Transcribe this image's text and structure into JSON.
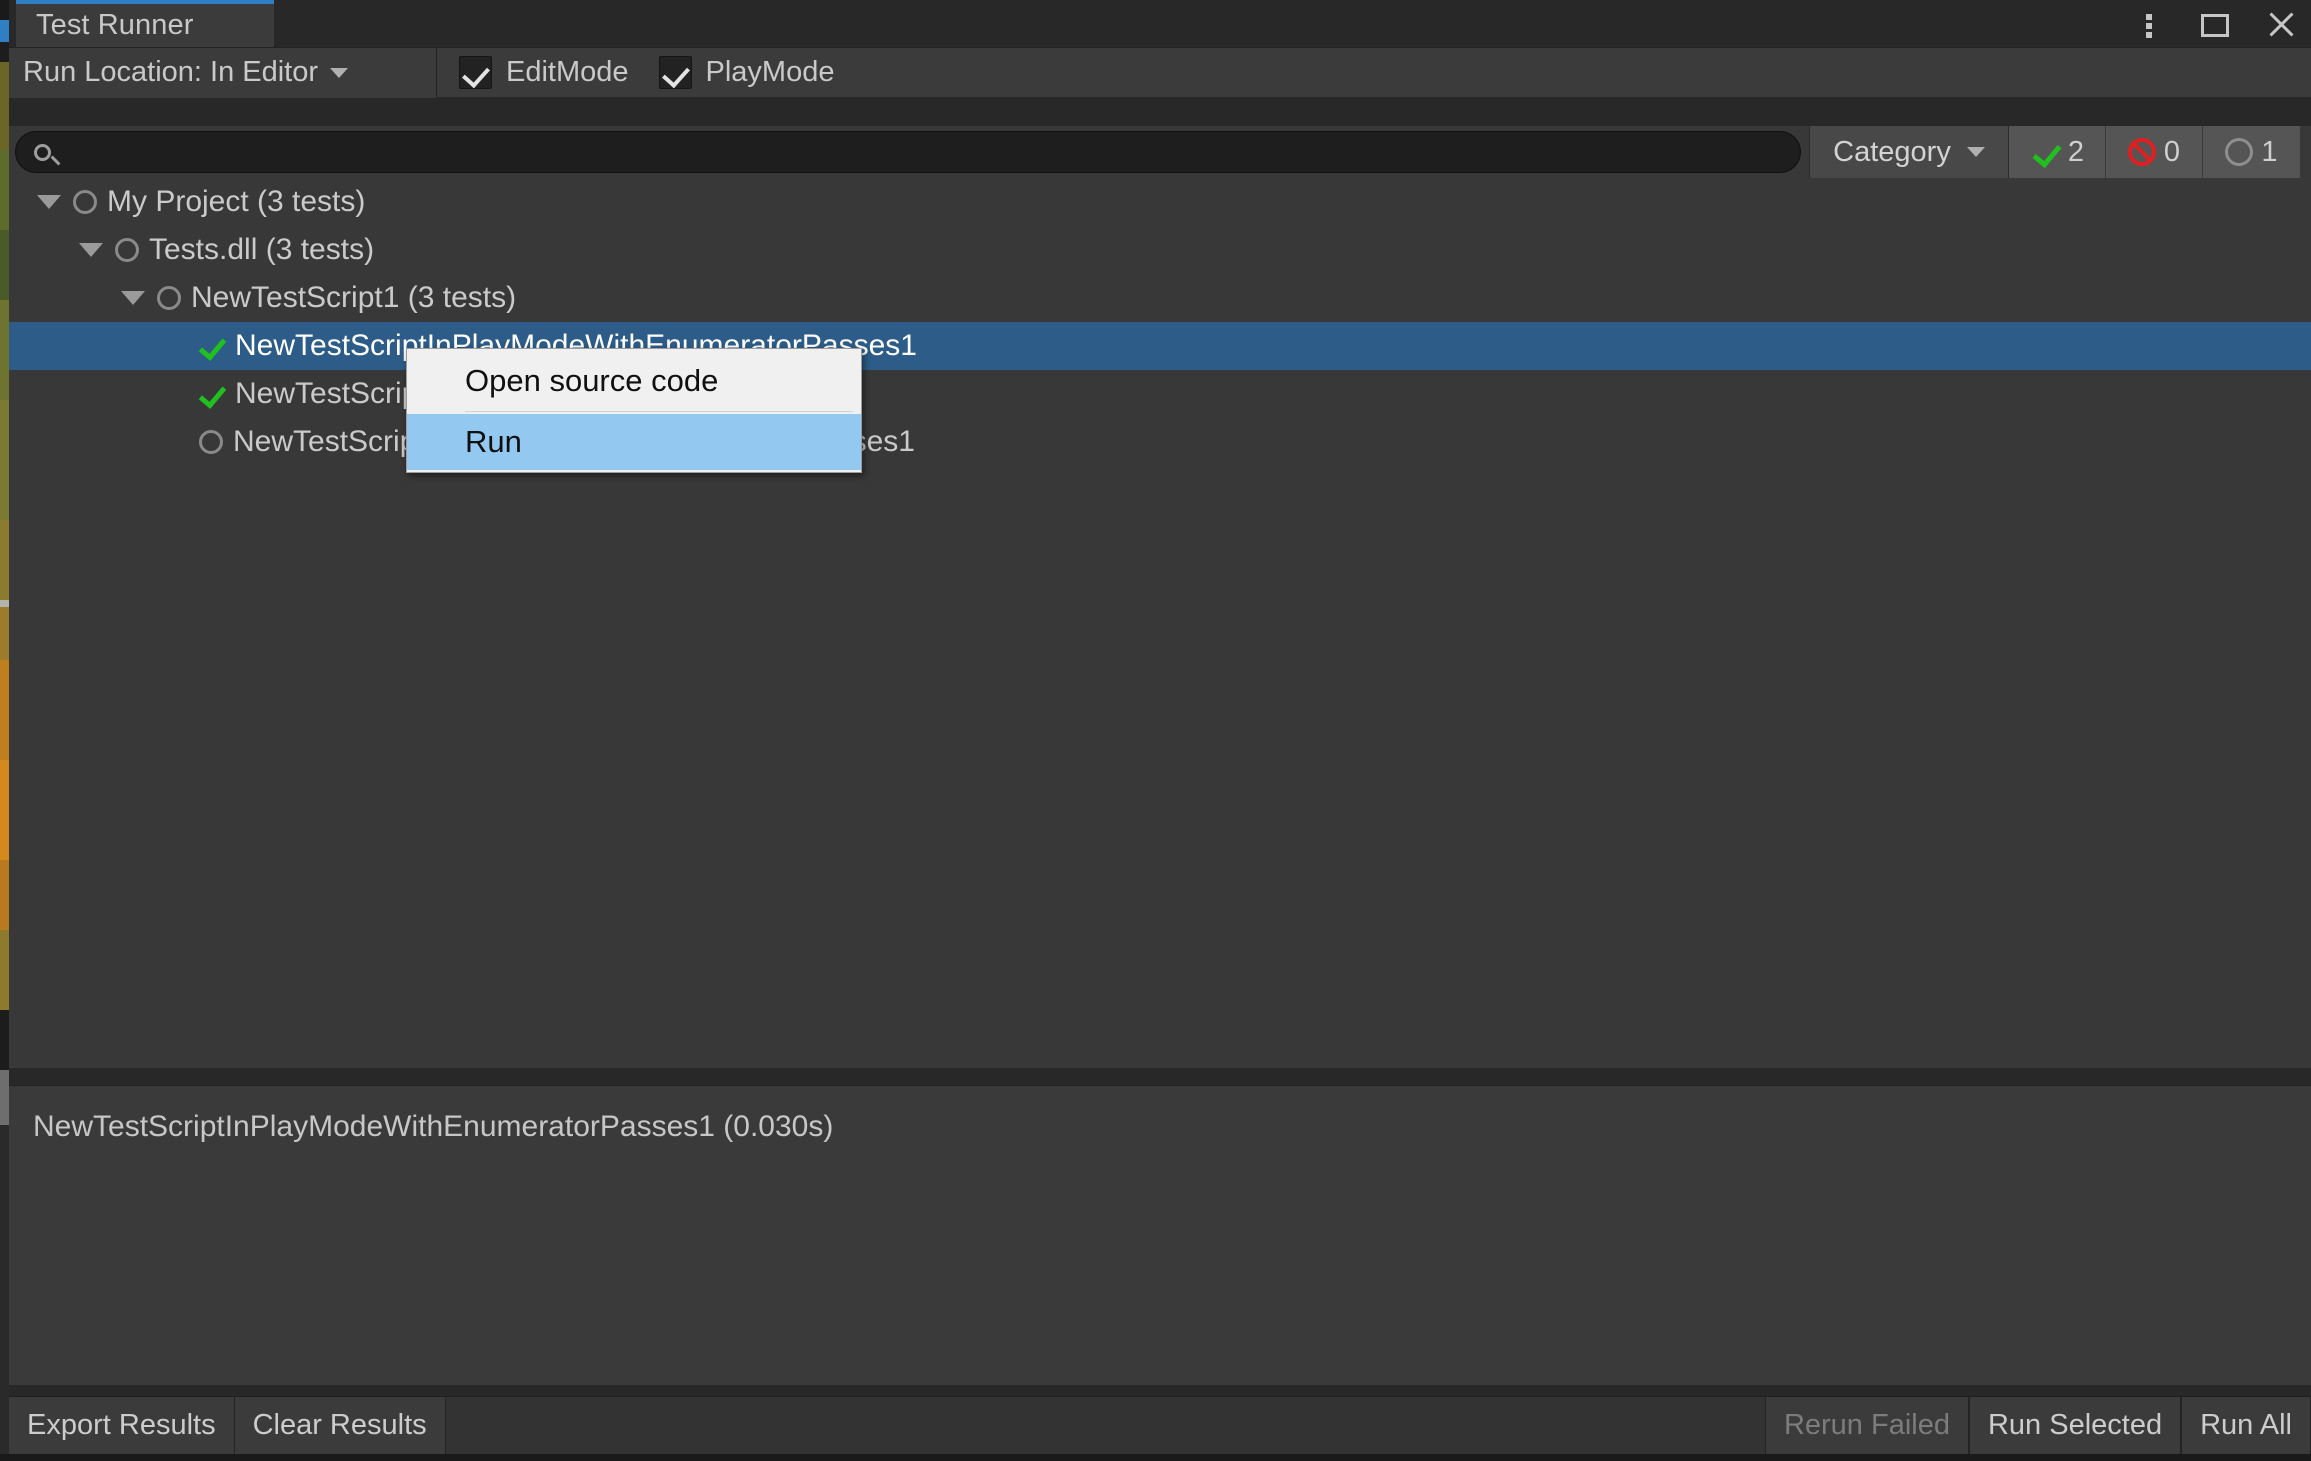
{
  "window": {
    "tab_label": "Test Runner",
    "controls": [
      {
        "name": "kebab-menu-icon",
        "label": "More options"
      },
      {
        "name": "maximize-icon",
        "label": "Maximize"
      },
      {
        "name": "close-icon",
        "label": "Close"
      }
    ]
  },
  "toolbar": {
    "run_location": "Run Location: In Editor",
    "modes": [
      {
        "label": "EditMode",
        "checked": true
      },
      {
        "label": "PlayMode",
        "checked": true
      }
    ]
  },
  "search": {
    "value": "",
    "placeholder": "",
    "icon": "search-icon",
    "category_label": "Category",
    "counts": {
      "passed": "2",
      "failed": "0",
      "not_run": "1"
    }
  },
  "tree": {
    "rows": [
      {
        "label": "My Project (3 tests)",
        "depth": 0,
        "expanded": true,
        "status": "not-run",
        "selected": false
      },
      {
        "label": "Tests.dll (3 tests)",
        "depth": 1,
        "expanded": true,
        "status": "not-run",
        "selected": false
      },
      {
        "label": "NewTestScript1 (3 tests)",
        "depth": 2,
        "expanded": true,
        "status": "not-run",
        "selected": false
      },
      {
        "label": "NewTestScriptInPlayModeWithEnumeratorPasses1",
        "depth": 3,
        "expanded": false,
        "status": "passed",
        "selected": true
      },
      {
        "label": "NewTestScriptSimplePasses1",
        "depth": 3,
        "expanded": false,
        "status": "passed",
        "selected": false
      },
      {
        "label": "NewTestScriptInPlayModeWithEnumeratorPasses1",
        "depth": 3,
        "expanded": false,
        "status": "not-run",
        "selected": false
      }
    ]
  },
  "context_menu": {
    "items": [
      {
        "label": "Open source code",
        "highlighted": false
      },
      {
        "label": "Run",
        "highlighted": true
      }
    ]
  },
  "detail": {
    "text": "NewTestScriptInPlayModeWithEnumeratorPasses1 (0.030s)"
  },
  "bottom_bar": {
    "left_buttons": [
      {
        "label": "Export Results",
        "disabled": false
      },
      {
        "label": "Clear Results",
        "disabled": false
      }
    ],
    "right_buttons": [
      {
        "label": "Rerun Failed",
        "disabled": true
      },
      {
        "label": "Run Selected",
        "disabled": false
      },
      {
        "label": "Run All",
        "disabled": false
      }
    ]
  },
  "colors": {
    "accent_tab": "#2f7fc4",
    "selection": "#2c5c87",
    "panel_bg": "#383838",
    "toolbar_bg": "#3b3b3b",
    "pass_green": "#1fc01f",
    "fail_red": "#e02020",
    "menu_highlight": "#93c9f0"
  }
}
